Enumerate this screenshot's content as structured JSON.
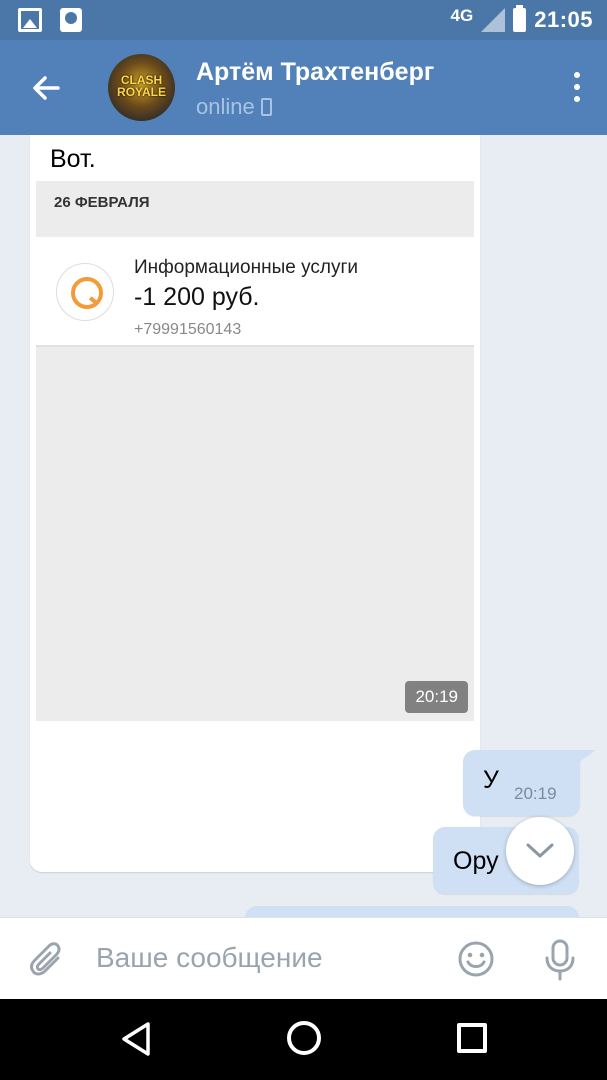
{
  "statusbar": {
    "network": "4G",
    "time": "21:05"
  },
  "header": {
    "name": "Артём Трахтенберг",
    "status": "online",
    "avatar_text": "CLASH ROYALE"
  },
  "messages": {
    "incoming": {
      "text": "Вот.",
      "attachment": {
        "date": "26 ФЕВРАЛЯ",
        "service": "Информационные услуги",
        "amount": "-1 200 руб.",
        "phone": "+79991560143",
        "time": "20:19"
      }
    },
    "outgoing": [
      {
        "text": "У",
        "time": "20:19"
      },
      {
        "text": "Ору"
      }
    ]
  },
  "composer": {
    "placeholder": "Ваше сообщение"
  },
  "colors": {
    "header": "#5181b8",
    "statusbar": "#4a76a8",
    "outgoing_bubble": "#cfe0f5",
    "qiwi": "#f39b36"
  }
}
